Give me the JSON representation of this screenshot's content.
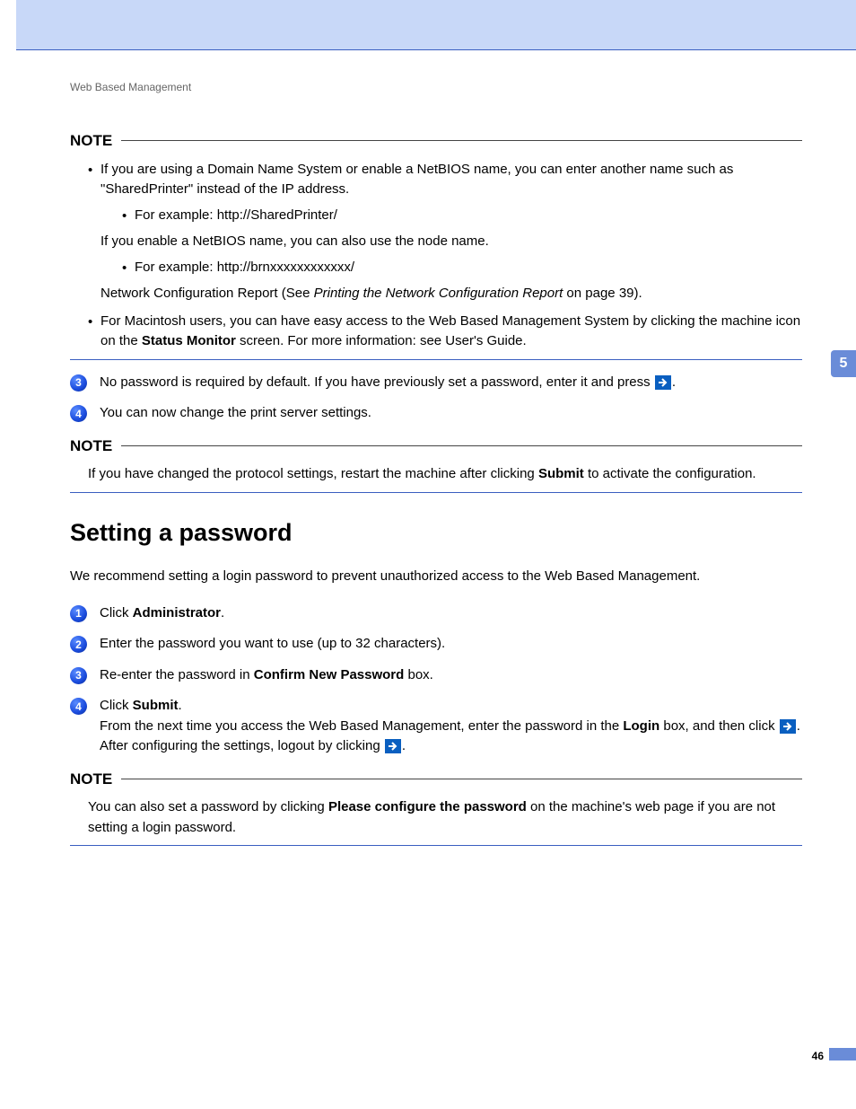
{
  "header": {
    "label": "Web Based Management"
  },
  "sideTab": "5",
  "pageNumber": "46",
  "note1": {
    "heading": "NOTE",
    "b1_pre": "If you are using a Domain Name System or enable a NetBIOS name, you can enter another name such as \"SharedPrinter\" instead of the IP address.",
    "b1_sub1": "For example: http://SharedPrinter/",
    "b1_mid": "If you enable a NetBIOS name, you can also use the node name.",
    "b1_sub2": "For example: http://brnxxxxxxxxxxxx/",
    "b1_net_pre": "Network Configuration Report (See ",
    "b1_net_italic": "Printing the Network Configuration Report",
    "b1_net_post": " on page 39).",
    "b2_pre": "For Macintosh users, you can have easy access to the Web Based Management System by clicking the machine icon on the ",
    "b2_bold": "Status Monitor",
    "b2_post": " screen. For more information: see User's Guide."
  },
  "steps_a": {
    "s3": "No password is required by default. If you have previously set a password, enter it and press ",
    "s3_end": ".",
    "s4": "You can now change the print server settings."
  },
  "note2": {
    "heading": "NOTE",
    "text_pre": "If you have changed the protocol settings, restart the machine after clicking ",
    "text_bold": "Submit",
    "text_post": " to activate the configuration."
  },
  "section": {
    "title": "Setting a password",
    "intro": "We recommend setting a login password to prevent unauthorized access to the Web Based Management."
  },
  "steps_b": {
    "s1_pre": "Click ",
    "s1_bold": "Administrator",
    "s1_post": ".",
    "s2": "Enter the password you want to use (up to 32 characters).",
    "s3_pre": "Re-enter the password in ",
    "s3_bold": "Confirm New Password",
    "s3_post": " box.",
    "s4_pre": "Click ",
    "s4_bold": "Submit",
    "s4_post": ".",
    "s4_line2_pre": "From the next time you access the Web Based Management, enter the password in the ",
    "s4_line2_bold": "Login",
    "s4_line2_post": " box, and then click ",
    "s4_line2_end": ".",
    "s4_line3_pre": "After configuring the settings, logout by clicking ",
    "s4_line3_end": "."
  },
  "note3": {
    "heading": "NOTE",
    "pre": "You can also set a password by clicking ",
    "bold": "Please configure the password",
    "post": " on the machine's web page if you are not setting a login password."
  }
}
